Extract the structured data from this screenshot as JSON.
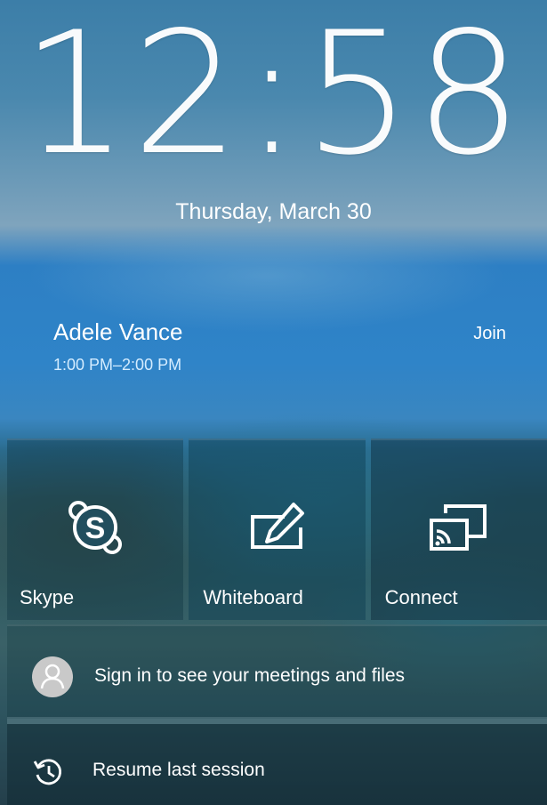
{
  "lockscreen": {
    "time": "12:58",
    "date": "Thursday, March 30"
  },
  "meeting": {
    "organizer": "Adele Vance",
    "time_range": "1:00 PM–2:00 PM",
    "join_label": "Join"
  },
  "tiles": [
    {
      "label": "Skype",
      "icon": "skype-icon"
    },
    {
      "label": "Whiteboard",
      "icon": "whiteboard-pen-icon"
    },
    {
      "label": "Connect",
      "icon": "cast-screen-icon"
    }
  ],
  "signin": {
    "text": "Sign in to see your meetings and files",
    "icon": "person-avatar-icon"
  },
  "resume": {
    "text": "Resume last session",
    "icon": "history-clock-icon"
  },
  "colors": {
    "text": "#ffffff",
    "meeting_time": "#d4ecff",
    "avatar": "#c9c9c9"
  }
}
